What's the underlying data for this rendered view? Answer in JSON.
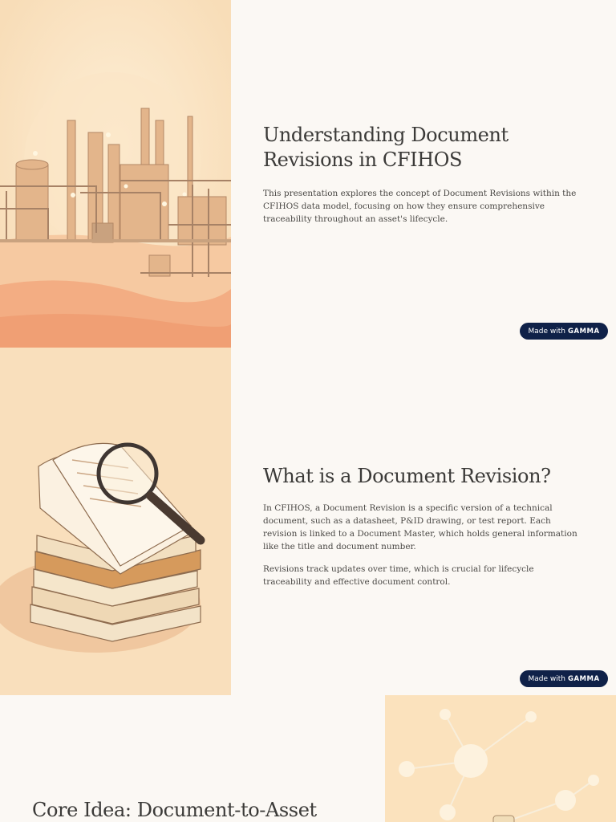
{
  "slides": [
    {
      "title": "Understanding Document Revisions in CFIHOS",
      "body": "This presentation explores the concept of Document Revisions within the CFIHOS data model, focusing on how they ensure comprehensive traceability throughout an asset's lifecycle.",
      "illustration": "industrial-plant-illustration"
    },
    {
      "title": "What is a Document Revision?",
      "paragraphs": [
        "In CFIHOS, a Document Revision is a specific version of a technical document, such as a datasheet, P&ID drawing, or test report. Each revision is linked to a Document Master, which holds general information like the title and document number.",
        "Revisions track updates over time, which is crucial for lifecycle traceability and effective document control."
      ],
      "illustration": "books-magnifier-illustration"
    },
    {
      "title": "Core Idea: Document-to-Asset",
      "illustration": "network-nodes-illustration"
    }
  ],
  "badge": {
    "prefix": "Made with",
    "brand": "GAMMA"
  },
  "colors": {
    "page_bg": "#fbf8f4",
    "art_bg": "#f9dfbc",
    "badge_bg": "#0f2148"
  }
}
